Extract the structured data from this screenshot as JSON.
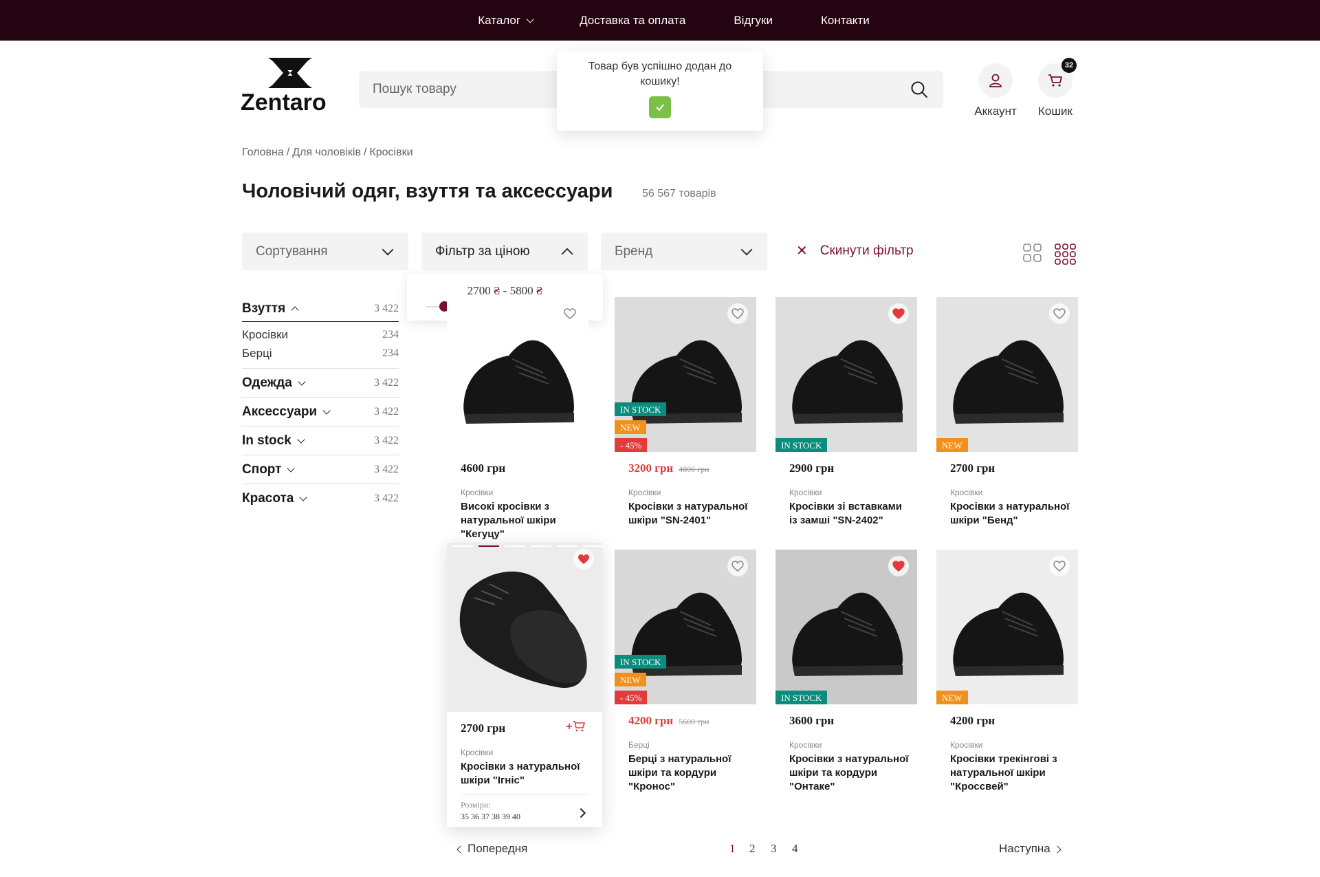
{
  "topnav": {
    "items": [
      {
        "label": "Каталог"
      },
      {
        "label": "Доставка та оплата"
      },
      {
        "label": "Відгуки"
      },
      {
        "label": "Контакти"
      }
    ]
  },
  "header": {
    "logo_text": "Zentaro",
    "search_placeholder": "Пошук товару",
    "account_label": "Аккаунт",
    "cart_label": "Кошик",
    "cart_count": "32"
  },
  "toast": {
    "message": "Товар був успішно додан до кошику!"
  },
  "breadcrumb": [
    "Головна",
    "/",
    "Для чоловіків",
    "/",
    "Кросівки"
  ],
  "page": {
    "title": "Чоловічий одяг, взуття та аксессуари",
    "count": "56 567 товарів"
  },
  "filters": {
    "sort_label": "Сортування",
    "price_label": "Фільтр за ціною",
    "brand_label": "Бренд",
    "reset_label": "Скинути фільтр",
    "price_min": "2700",
    "price_max": "5800",
    "currency": "₴",
    "price_separator": " - ",
    "range_fill_fraction": [
      0.12,
      0.75
    ]
  },
  "sidebar": {
    "categories": [
      {
        "name": "Взуття",
        "count": "3 422",
        "open": true,
        "subs": [
          {
            "name": "Кросівки",
            "count": "234"
          },
          {
            "name": "Берці",
            "count": "234"
          }
        ]
      },
      {
        "name": "Одежда",
        "count": "3 422"
      },
      {
        "name": "Аксессуари",
        "count": "3 422"
      },
      {
        "name": "In stock",
        "count": "3 422"
      },
      {
        "name": "Спорт",
        "count": "3 422"
      },
      {
        "name": "Красота",
        "count": "3 422"
      }
    ]
  },
  "products": [
    {
      "price": "4600 грн",
      "old_price": "",
      "category": "Кросівки",
      "name": "Високі кросівки з натуральної шкіри \"Кегуцу\"",
      "tags": [],
      "favorite": false,
      "sale": false
    },
    {
      "price": "3200 грн",
      "old_price": "4800 грн",
      "category": "Кросівки",
      "name": "Кросівки з натуральної шкіри \"SN-2401\"",
      "tags": [
        "IN STOCK",
        "NEW",
        "- 45%"
      ],
      "favorite": false,
      "sale": true
    },
    {
      "price": "2900 грн",
      "old_price": "",
      "category": "Кросівки",
      "name": "Кросівки зі вставками із замші \"SN-2402\"",
      "tags": [
        "IN STOCK"
      ],
      "favorite": true,
      "sale": false
    },
    {
      "price": "2700 грн",
      "old_price": "",
      "category": "Кросівки",
      "name": "Кросівки з натуральної шкіри \"Бенд\"",
      "tags": [
        "NEW"
      ],
      "favorite": false,
      "sale": false
    },
    {
      "price": "2700 грн",
      "old_price": "",
      "category": "Кросівки",
      "name": "Кросівки з натуральної шкіри \"Ігніс\"",
      "tags": [],
      "favorite": true,
      "sale": false,
      "sizes_label": "Розміри:",
      "sizes": "35 36 37 38 39 40"
    },
    {
      "price": "4200 грн",
      "old_price": "5600 грн",
      "category": "Берці",
      "name": "Берці з натуральної шкіри та кордури \"Кронос\"",
      "tags": [
        "IN STOCK",
        "NEW",
        "- 45%"
      ],
      "favorite": false,
      "sale": true
    },
    {
      "price": "3600 грн",
      "old_price": "",
      "category": "Кросівки",
      "name": "Кросівки з натуральної шкіри та кордури \"Онтаке\"",
      "tags": [
        "IN STOCK"
      ],
      "favorite": true,
      "sale": false
    },
    {
      "price": "4200 грн",
      "old_price": "",
      "category": "Кросівки",
      "name": "Кросівки трекінгові з натуральної шкіри \"Кроссвей\"",
      "tags": [
        "NEW"
      ],
      "favorite": false,
      "sale": false
    }
  ],
  "pagination": {
    "prev_label": "Попередня",
    "next_label": "Наступна",
    "pages": [
      "1",
      "2",
      "3",
      "4"
    ],
    "current": "1"
  },
  "colors": {
    "brand": "#230410",
    "accent": "#7a1030",
    "in_stock": "#0b8c7d",
    "new": "#f0901d",
    "sale": "#e23b3b",
    "success": "#7cc04a"
  }
}
